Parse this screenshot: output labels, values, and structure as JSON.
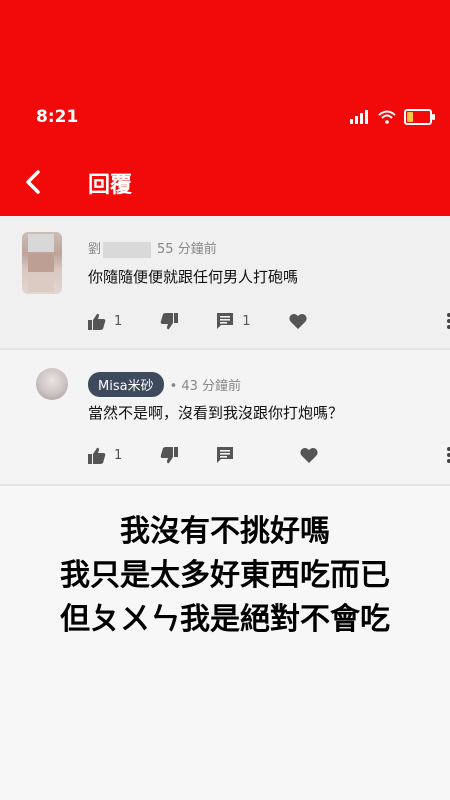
{
  "status_bar": {
    "time": "8:21"
  },
  "app_bar": {
    "title": "回覆"
  },
  "comments": [
    {
      "author": "劉",
      "time": "55 分鐘前",
      "text": "你隨隨便便就跟任何男人打砲嗎",
      "likes": "1",
      "replies": "1"
    },
    {
      "author": "Misa米砂",
      "time": "• 43 分鐘前",
      "text": "當然不是啊，沒看到我沒跟你打炮嗎？",
      "likes": "1"
    }
  ],
  "caption_lines": [
    "我沒有不挑好嗎",
    "我只是太多好東西吃而已",
    "但ㄆㄨㄣ我是絕對不會吃"
  ]
}
